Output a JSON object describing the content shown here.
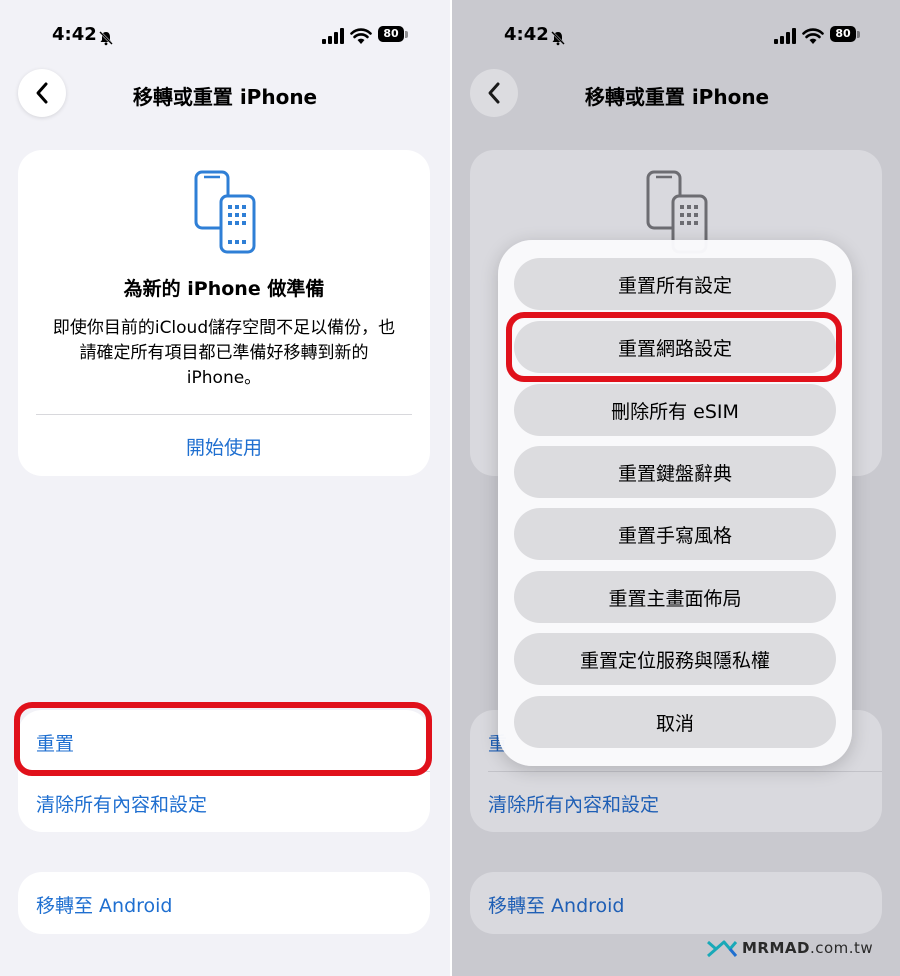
{
  "status_bar": {
    "time": "4:42",
    "battery": "80"
  },
  "left": {
    "nav_title": "移轉或重置 iPhone",
    "prepare_card": {
      "title": "為新的 iPhone 做準備",
      "body": "即使你目前的iCloud儲存空間不足以備份，也請確定所有項目都已準備好移轉到新的iPhone。",
      "link": "開始使用"
    },
    "reset_label": "重置",
    "erase_label": "清除所有內容和設定",
    "android_label": "移轉至 Android"
  },
  "right": {
    "nav_title": "移轉或重置 iPhone",
    "reset_label": "重",
    "erase_label": "清除所有內容和設定",
    "android_label": "移轉至 Android",
    "reset_menu": {
      "options": [
        "重置所有設定",
        "重置網路設定",
        "刪除所有 eSIM",
        "重置鍵盤辭典",
        "重置手寫風格",
        "重置主畫面佈局",
        "重置定位服務與隱私權",
        "取消"
      ]
    }
  },
  "watermark": {
    "brand": "MRMAD",
    "domain": ".com.tw"
  },
  "colors": {
    "accent": "#1f6fd0",
    "highlight": "#e0111b",
    "icon_blue": "#2f7fd6"
  },
  "icons": [
    "back-chevron-icon",
    "bell-slash-icon",
    "signal-icon",
    "wifi-icon",
    "battery-icon",
    "phone-transfer-icon"
  ]
}
